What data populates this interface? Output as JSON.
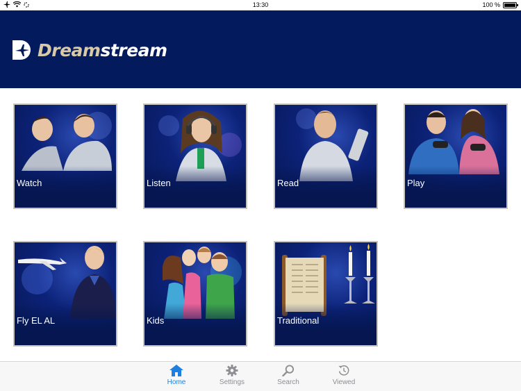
{
  "status_bar": {
    "time": "13:30",
    "battery": "100 %"
  },
  "header": {
    "logo_part1": "Dream",
    "logo_part2": "stream"
  },
  "tiles": [
    {
      "label": "Watch"
    },
    {
      "label": "Listen"
    },
    {
      "label": "Read"
    },
    {
      "label": "Play"
    },
    {
      "label": "Fly EL AL"
    },
    {
      "label": "Kids"
    },
    {
      "label": "Traditional"
    }
  ],
  "tab_bar": {
    "tabs": [
      {
        "label": "Home",
        "icon": "home-icon",
        "active": true
      },
      {
        "label": "Settings",
        "icon": "gear-icon",
        "active": false
      },
      {
        "label": "Search",
        "icon": "search-icon",
        "active": false
      },
      {
        "label": "Viewed",
        "icon": "history-icon",
        "active": false
      }
    ]
  },
  "colors": {
    "header_bg": "#031a5c",
    "tile_bg": "#051650",
    "tab_active": "#1e7fe0",
    "tab_inactive": "#8e8e93"
  }
}
